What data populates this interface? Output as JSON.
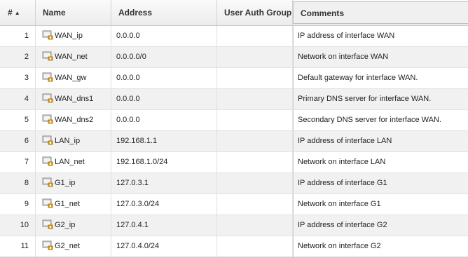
{
  "table": {
    "columns": {
      "number": "#",
      "name": "Name",
      "address": "Address",
      "user_auth_group": "User Auth Group",
      "comments": "Comments"
    },
    "sort": {
      "column": "number",
      "direction": "ascending",
      "icon": "sort-ascending-icon"
    },
    "row_icon": "address-object-icon",
    "rows": [
      {
        "num": "1",
        "name": "WAN_ip",
        "address": "0.0.0.0",
        "user_auth_group": "",
        "comment": "IP address of interface WAN"
      },
      {
        "num": "2",
        "name": "WAN_net",
        "address": "0.0.0.0/0",
        "user_auth_group": "",
        "comment": "Network on interface WAN"
      },
      {
        "num": "3",
        "name": "WAN_gw",
        "address": "0.0.0.0",
        "user_auth_group": "",
        "comment": "Default gateway for interface WAN."
      },
      {
        "num": "4",
        "name": "WAN_dns1",
        "address": "0.0.0.0",
        "user_auth_group": "",
        "comment": "Primary DNS server for interface WAN."
      },
      {
        "num": "5",
        "name": "WAN_dns2",
        "address": "0.0.0.0",
        "user_auth_group": "",
        "comment": "Secondary DNS server for interface WAN."
      },
      {
        "num": "6",
        "name": "LAN_ip",
        "address": "192.168.1.1",
        "user_auth_group": "",
        "comment": "IP address of interface LAN"
      },
      {
        "num": "7",
        "name": "LAN_net",
        "address": "192.168.1.0/24",
        "user_auth_group": "",
        "comment": "Network on interface LAN"
      },
      {
        "num": "8",
        "name": "G1_ip",
        "address": "127.0.3.1",
        "user_auth_group": "",
        "comment": "IP address of interface G1"
      },
      {
        "num": "9",
        "name": "G1_net",
        "address": "127.0.3.0/24",
        "user_auth_group": "",
        "comment": "Network on interface G1"
      },
      {
        "num": "10",
        "name": "G2_ip",
        "address": "127.0.4.1",
        "user_auth_group": "",
        "comment": "IP address of interface G2"
      },
      {
        "num": "11",
        "name": "G2_net",
        "address": "127.0.4.0/24",
        "user_auth_group": "",
        "comment": "Network on interface G2"
      }
    ]
  }
}
